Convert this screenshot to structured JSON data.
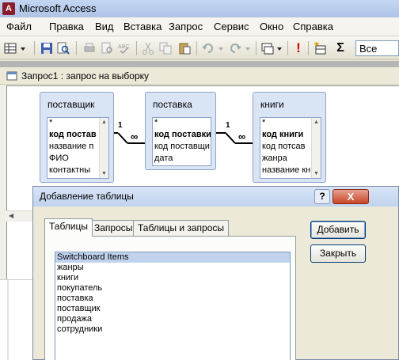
{
  "app": {
    "title": "Microsoft Access"
  },
  "menu": [
    "Файл",
    "Правка",
    "Вид",
    "Вставка",
    "Запрос",
    "Сервис",
    "Окно",
    "Справка"
  ],
  "toolbar": {
    "view_combo_value": "Все",
    "sigma_label": "Σ",
    "run_label": "!"
  },
  "query_window": {
    "title": "Запрос1 : запрос на выборку"
  },
  "tables": [
    {
      "name": "поставщик",
      "fields": [
        "*",
        "код постав",
        "название п",
        "ФИО",
        "контактны"
      ],
      "pk_index": 1
    },
    {
      "name": "поставка",
      "fields": [
        "*",
        "код поставки",
        "код поставщи",
        "дата"
      ],
      "pk_index": 1
    },
    {
      "name": "книги",
      "fields": [
        "*",
        "код книги",
        "код потсав",
        "жанра",
        "название кн"
      ],
      "pk_index": 1
    }
  ],
  "relationships": [
    {
      "one": "1",
      "many": "∞"
    },
    {
      "one": "1",
      "many": "∞"
    }
  ],
  "dialog": {
    "title": "Добавление таблицы",
    "help_label": "?",
    "close_label": "X",
    "tabs": [
      "Таблицы",
      "Запросы",
      "Таблицы и запросы"
    ],
    "items": [
      "Switchboard Items",
      "жанры",
      "книги",
      "покупатель",
      "поставка",
      "поставщик",
      "продажа",
      "сотрудники"
    ],
    "add_button": "Добавить",
    "close_button": "Закрыть"
  },
  "colors": {
    "titlebar": "#c4d6f2",
    "selection": "#c1d2ee",
    "close": "#c8452b"
  }
}
